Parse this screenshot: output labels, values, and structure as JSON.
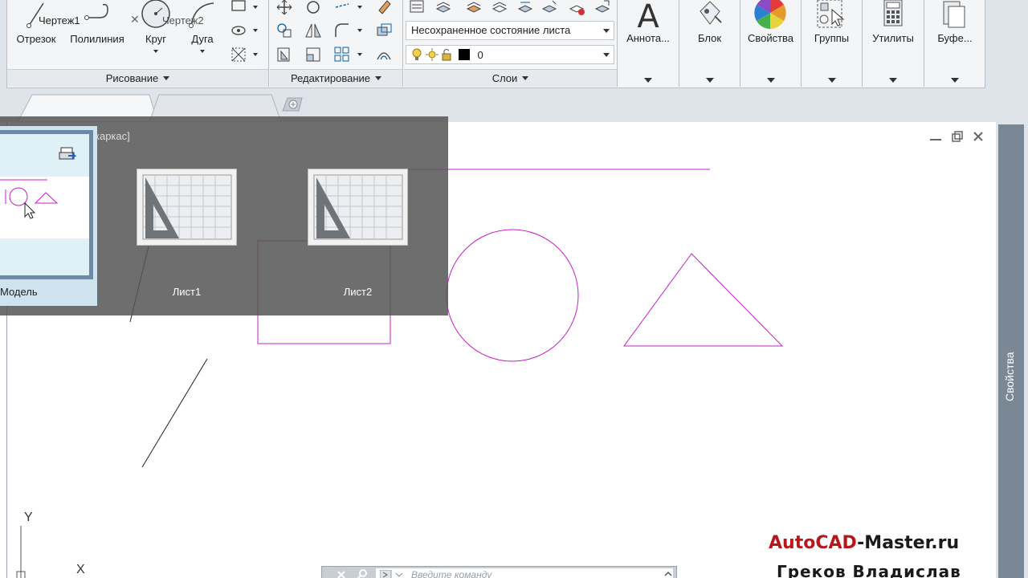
{
  "ribbon": {
    "draw_tools": [
      "Отрезок",
      "Полилиния",
      "Круг",
      "Дуга"
    ],
    "panels": {
      "draw": "Рисование",
      "modify": "Редактирование",
      "layers": "Слои"
    },
    "layer_state": "Несохраненное состояние листа",
    "current_layer": "0",
    "right_panels": [
      "Аннота...",
      "Блок",
      "Свойства",
      "Группы",
      "Утилиты",
      "Буфе..."
    ]
  },
  "tabs": [
    {
      "label": "Чертеж1",
      "active": true
    },
    {
      "label": "Чертеж2",
      "active": false
    }
  ],
  "layout_preview": {
    "viewport_label": "каркас]",
    "model": "Модель",
    "sheets": [
      "Лист1",
      "Лист2"
    ]
  },
  "side_palette": {
    "label": "Свойства"
  },
  "command_line": {
    "placeholder": "Введите команду"
  },
  "ucs": {
    "y": "Y",
    "x": "X"
  },
  "watermark": {
    "site_part1": "AutoCAD",
    "site_part2": "-Master.ru",
    "author": "Греков Владислав"
  },
  "colors": {
    "drawing_magenta": "#c81ec8",
    "ribbon_bg": "#f3f5f7",
    "tab_strip": "#dfe4ea",
    "watermark_red": "#b7161b"
  }
}
